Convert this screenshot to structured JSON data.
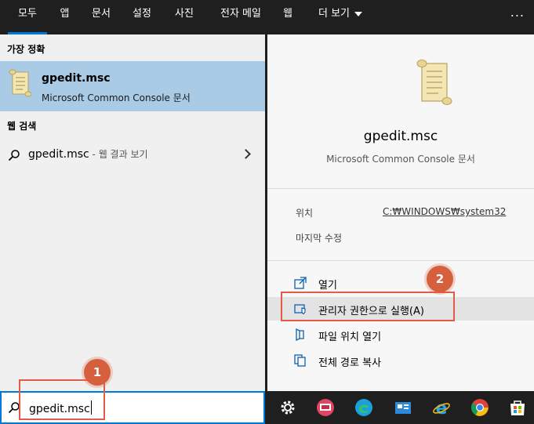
{
  "nav": {
    "tabs": [
      "모두",
      "앱",
      "문서",
      "설정",
      "사진",
      "전자 메일",
      "웹",
      "더 보기"
    ],
    "more_menu": "...",
    "active_tab": "모두"
  },
  "left": {
    "best_match_title": "가장 정확",
    "best": {
      "name": "gpedit.msc",
      "desc": "Microsoft Common Console 문서"
    },
    "web_title": "웹 검색",
    "web": {
      "query": "gpedit.msc",
      "suffix": " - 웹 결과 보기"
    }
  },
  "right": {
    "name": "gpedit.msc",
    "desc": "Microsoft Common Console 문서",
    "location_label": "위치",
    "location_value": "C:₩WINDOWS₩system32",
    "modified_label": "마지막 수정",
    "actions": [
      "열기",
      "관리자 권한으로 실행(A)",
      "파일 위치 열기",
      "전체 경로 복사"
    ]
  },
  "search": {
    "value": "gpedit.msc"
  },
  "badges": [
    "1",
    "2"
  ],
  "taskbar": [
    "settings-icon",
    "screen-app-icon",
    "edge-icon",
    "store-app-icon",
    "ie-icon",
    "chrome-icon",
    "microsoft-store-icon"
  ],
  "colors": {
    "accent": "#0078d7",
    "selection": "#a9cbe6",
    "badge": "#d65f3d",
    "highlight_border": "#e25b4a"
  }
}
